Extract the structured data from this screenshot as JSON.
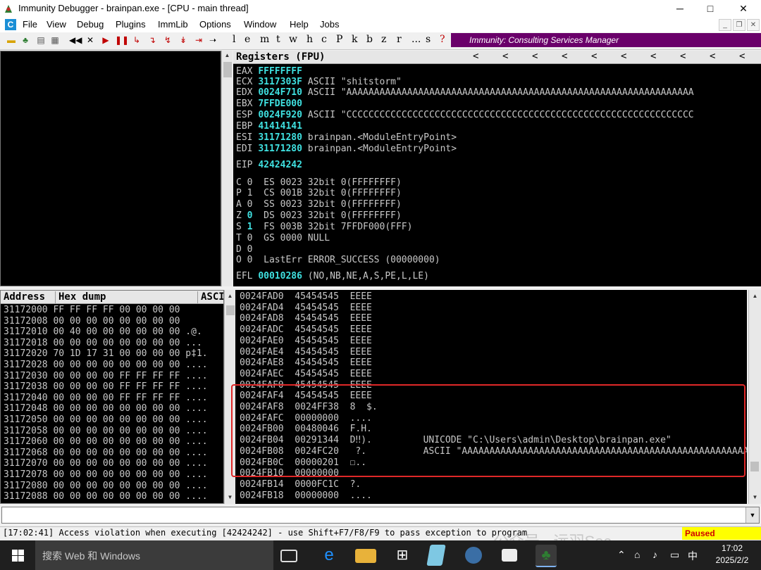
{
  "window": {
    "title": "Immunity Debugger - brainpan.exe - [CPU - main thread]",
    "controls": [
      "─",
      "□",
      "✕"
    ]
  },
  "menu": {
    "items": [
      "File",
      "View",
      "Debug",
      "Plugins",
      "ImmLib",
      "Options",
      "Window",
      "Help",
      "Jobs"
    ]
  },
  "toolbar": {
    "letters": [
      "l",
      "e",
      "m",
      "t",
      "w",
      "h",
      "c",
      "P",
      "k",
      "b",
      "z",
      "r",
      "...",
      "s",
      "?"
    ],
    "banner": "Immunity: Consulting Services Manager"
  },
  "registers": {
    "header": "Registers (FPU)",
    "rows": [
      {
        "name": "EAX",
        "value": "FFFFFFFF",
        "comment": ""
      },
      {
        "name": "ECX",
        "value": "3117303F",
        "comment": "ASCII \"shitstorm\""
      },
      {
        "name": "EDX",
        "value": "0024F710",
        "comment": "ASCII \"AAAAAAAAAAAAAAAAAAAAAAAAAAAAAAAAAAAAAAAAAAAAAAAAAAAAAAAAAAAAAAA"
      },
      {
        "name": "EBX",
        "value": "7FFDE000",
        "comment": ""
      },
      {
        "name": "ESP",
        "value": "0024F920",
        "comment": "ASCII \"CCCCCCCCCCCCCCCCCCCCCCCCCCCCCCCCCCCCCCCCCCCCCCCCCCCCCCCCCCCCCCC"
      },
      {
        "name": "EBP",
        "value": "41414141",
        "comment": ""
      },
      {
        "name": "ESI",
        "value": "31171280",
        "comment": "brainpan.<ModuleEntryPoint>"
      },
      {
        "name": "EDI",
        "value": "31171280",
        "comment": "brainpan.<ModuleEntryPoint>"
      }
    ],
    "eip": {
      "name": "EIP",
      "value": "42424242"
    },
    "flags": [
      {
        "flag": "C",
        "bit": "0",
        "text": "ES 0023 32bit 0(FFFFFFFF)"
      },
      {
        "flag": "P",
        "bit": "1",
        "text": "CS 001B 32bit 0(FFFFFFFF)"
      },
      {
        "flag": "A",
        "bit": "0",
        "text": "SS 0023 32bit 0(FFFFFFFF)"
      },
      {
        "flag": "Z",
        "bit": "0",
        "text": "DS 0023 32bit 0(FFFFFFFF)"
      },
      {
        "flag": "S",
        "bit": "1",
        "text": "FS 003B 32bit 7FFDF000(FFF)"
      },
      {
        "flag": "T",
        "bit": "0",
        "text": "GS 0000 NULL"
      },
      {
        "flag": "D",
        "bit": "0",
        "text": ""
      },
      {
        "flag": "O",
        "bit": "0",
        "text": "LastErr ERROR_SUCCESS (00000000)"
      }
    ],
    "efl": {
      "name": "EFL",
      "value": "00010286",
      "text": "(NO,NB,NE,A,S,PE,L,LE)"
    }
  },
  "dump": {
    "headers": [
      "Address",
      "Hex dump",
      "ASCI"
    ],
    "rows": [
      [
        "31172000",
        "FF FF FF FF 00 00 00 00",
        ""
      ],
      [
        "31172008",
        "00 00 00 00 00 00 00 00",
        ""
      ],
      [
        "31172010",
        "00 40 00 00 00 00 00 00",
        ".@."
      ],
      [
        "31172018",
        "00 00 00 00 00 00 00 00",
        "..."
      ],
      [
        "31172020",
        "70 1D 17 31 00 00 00 00",
        "p‡1."
      ],
      [
        "31172028",
        "00 00 00 00 00 00 00 00",
        "...."
      ],
      [
        "31172030",
        "00 00 00 00 FF FF FF FF",
        "...."
      ],
      [
        "31172038",
        "00 00 00 00 FF FF FF FF",
        "...."
      ],
      [
        "31172040",
        "00 00 00 00 FF FF FF FF",
        "...."
      ],
      [
        "31172048",
        "00 00 00 00 00 00 00 00",
        "...."
      ],
      [
        "31172050",
        "00 00 00 00 00 00 00 00",
        "...."
      ],
      [
        "31172058",
        "00 00 00 00 00 00 00 00",
        "...."
      ],
      [
        "31172060",
        "00 00 00 00 00 00 00 00",
        "...."
      ],
      [
        "31172068",
        "00 00 00 00 00 00 00 00",
        "...."
      ],
      [
        "31172070",
        "00 00 00 00 00 00 00 00",
        "...."
      ],
      [
        "31172078",
        "00 00 00 00 00 00 00 00",
        "...."
      ],
      [
        "31172080",
        "00 00 00 00 00 00 00 00",
        "...."
      ],
      [
        "31172088",
        "00 00 00 00 00 00 00 00",
        "...."
      ]
    ]
  },
  "stack": {
    "rows": [
      [
        "0024FAD0",
        "45454545",
        "EEEE",
        ""
      ],
      [
        "0024FAD4",
        "45454545",
        "EEEE",
        ""
      ],
      [
        "0024FAD8",
        "45454545",
        "EEEE",
        ""
      ],
      [
        "0024FADC",
        "45454545",
        "EEEE",
        ""
      ],
      [
        "0024FAE0",
        "45454545",
        "EEEE",
        ""
      ],
      [
        "0024FAE4",
        "45454545",
        "EEEE",
        ""
      ],
      [
        "0024FAE8",
        "45454545",
        "EEEE",
        ""
      ],
      [
        "0024FAEC",
        "45454545",
        "EEEE",
        ""
      ],
      [
        "0024FAF0",
        "45454545",
        "EEEE",
        ""
      ],
      [
        "0024FAF4",
        "45454545",
        "EEEE",
        ""
      ],
      [
        "0024FAF8",
        "0024FF38",
        "8  $.",
        ""
      ],
      [
        "0024FAFC",
        "00000000",
        "....",
        ""
      ],
      [
        "0024FB00",
        "00480046",
        "F.H.",
        ""
      ],
      [
        "0024FB04",
        "00291344",
        "D‼).",
        "UNICODE \"C:\\Users\\admin\\Desktop\\brainpan.exe\""
      ],
      [
        "0024FB08",
        "0024FC20",
        " ?.",
        "ASCII \"AAAAAAAAAAAAAAAAAAAAAAAAAAAAAAAAAAAAAAAAAAAAAAAAAAAAAAAAAAA"
      ],
      [
        "0024FB0C",
        "00000201",
        "☐..",
        ""
      ],
      [
        "0024FB10",
        "00000000",
        "",
        ""
      ],
      [
        "0024FB14",
        "0000FC1C",
        "?.",
        ""
      ],
      [
        "0024FB18",
        "00000000",
        "....",
        ""
      ]
    ]
  },
  "status": {
    "message": "[17:02:41] Access violation when executing [42424242] - use Shift+F7/F8/F9 to pass exception to program",
    "state": "Paused"
  },
  "taskbar": {
    "search_placeholder": "搜索 Web 和 Windows",
    "time": "17:02",
    "date": "2025/2/2",
    "ime": "中",
    "watermark": "公众号 · 远羽Sec"
  }
}
